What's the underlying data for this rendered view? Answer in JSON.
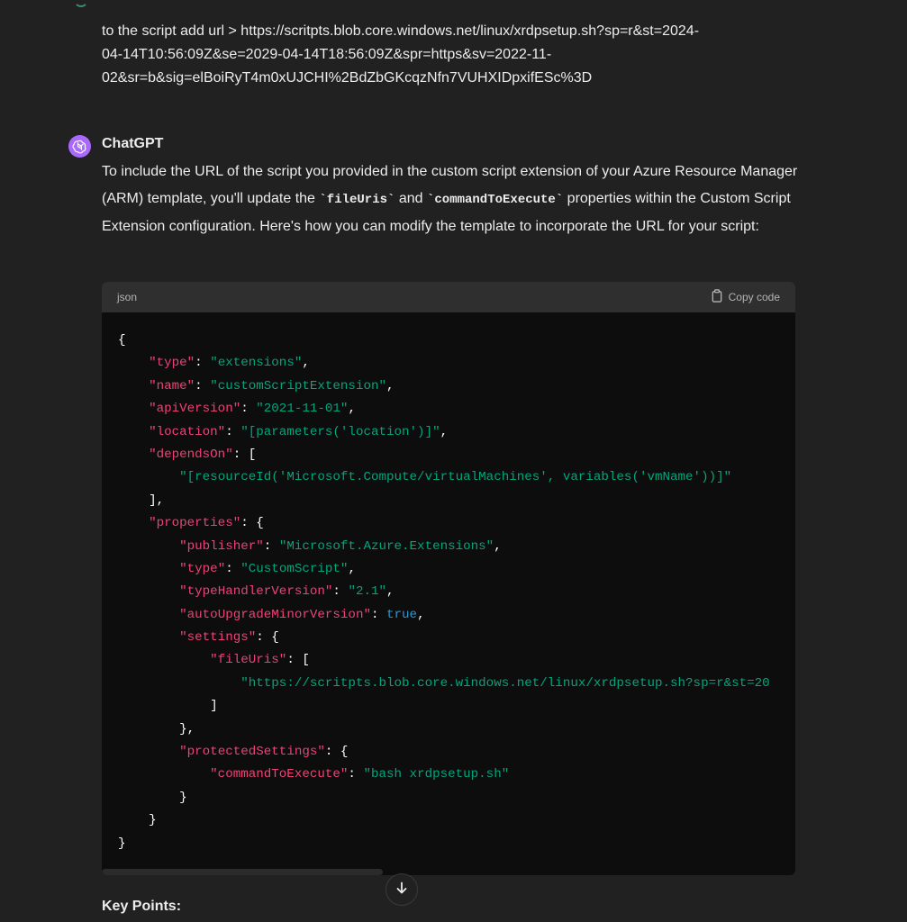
{
  "user_message": {
    "lines": [
      "to the script add url > https://scritpts.blob.core.windows.net/linux/xrdpsetup.sh?sp=r&st=2024-",
      "04-14T10:56:09Z&se=2029-04-14T18:56:09Z&spr=https&sv=2022-11-",
      "02&sr=b&sig=elBoiRyT4m0xUJCHI%2BdZbGKcqzNfn7VUHXIDpxifESc%3D"
    ]
  },
  "assistant": {
    "name": "ChatGPT",
    "intro_part1": "To include the URL of the script you provided in the custom script extension of your Azure Resource Manager (ARM) template, you'll update the ",
    "code1": "`fileUris`",
    "intro_part2": " and ",
    "code2": "`commandToExecute`",
    "intro_part3": " properties within the Custom Script Extension configuration. Here's how you can modify the template to incorporate the URL for your script:"
  },
  "code_block": {
    "language": "json",
    "copy_label": "Copy code",
    "lines": [
      [
        {
          "t": "{",
          "c": "p"
        }
      ],
      [
        {
          "t": "    "
        },
        {
          "t": "\"type\"",
          "c": "k"
        },
        {
          "t": ": ",
          "c": "p"
        },
        {
          "t": "\"extensions\"",
          "c": "s"
        },
        {
          "t": ",",
          "c": "p"
        }
      ],
      [
        {
          "t": "    "
        },
        {
          "t": "\"name\"",
          "c": "k"
        },
        {
          "t": ": ",
          "c": "p"
        },
        {
          "t": "\"customScriptExtension\"",
          "c": "s"
        },
        {
          "t": ",",
          "c": "p"
        }
      ],
      [
        {
          "t": "    "
        },
        {
          "t": "\"apiVersion\"",
          "c": "k"
        },
        {
          "t": ": ",
          "c": "p"
        },
        {
          "t": "\"2021-11-01\"",
          "c": "s"
        },
        {
          "t": ",",
          "c": "p"
        }
      ],
      [
        {
          "t": "    "
        },
        {
          "t": "\"location\"",
          "c": "k"
        },
        {
          "t": ": ",
          "c": "p"
        },
        {
          "t": "\"[parameters('location')]\"",
          "c": "s"
        },
        {
          "t": ",",
          "c": "p"
        }
      ],
      [
        {
          "t": "    "
        },
        {
          "t": "\"dependsOn\"",
          "c": "k"
        },
        {
          "t": ": [",
          "c": "p"
        }
      ],
      [
        {
          "t": "        "
        },
        {
          "t": "\"[resourceId('Microsoft.Compute/virtualMachines', variables('vmName'))]\"",
          "c": "s"
        }
      ],
      [
        {
          "t": "    "
        },
        {
          "t": "],",
          "c": "p"
        }
      ],
      [
        {
          "t": "    "
        },
        {
          "t": "\"properties\"",
          "c": "k"
        },
        {
          "t": ": {",
          "c": "p"
        }
      ],
      [
        {
          "t": "        "
        },
        {
          "t": "\"publisher\"",
          "c": "k"
        },
        {
          "t": ": ",
          "c": "p"
        },
        {
          "t": "\"Microsoft.Azure.Extensions\"",
          "c": "s"
        },
        {
          "t": ",",
          "c": "p"
        }
      ],
      [
        {
          "t": "        "
        },
        {
          "t": "\"type\"",
          "c": "k"
        },
        {
          "t": ": ",
          "c": "p"
        },
        {
          "t": "\"CustomScript\"",
          "c": "s"
        },
        {
          "t": ",",
          "c": "p"
        }
      ],
      [
        {
          "t": "        "
        },
        {
          "t": "\"typeHandlerVersion\"",
          "c": "k"
        },
        {
          "t": ": ",
          "c": "p"
        },
        {
          "t": "\"2.1\"",
          "c": "s"
        },
        {
          "t": ",",
          "c": "p"
        }
      ],
      [
        {
          "t": "        "
        },
        {
          "t": "\"autoUpgradeMinorVersion\"",
          "c": "k"
        },
        {
          "t": ": ",
          "c": "p"
        },
        {
          "t": "true",
          "c": "b"
        },
        {
          "t": ",",
          "c": "p"
        }
      ],
      [
        {
          "t": "        "
        },
        {
          "t": "\"settings\"",
          "c": "k"
        },
        {
          "t": ": {",
          "c": "p"
        }
      ],
      [
        {
          "t": "            "
        },
        {
          "t": "\"fileUris\"",
          "c": "k"
        },
        {
          "t": ": [",
          "c": "p"
        }
      ],
      [
        {
          "t": "                "
        },
        {
          "t": "\"https://scritpts.blob.core.windows.net/linux/xrdpsetup.sh?sp=r&st=20",
          "c": "s"
        }
      ],
      [
        {
          "t": "            "
        },
        {
          "t": "]",
          "c": "p"
        }
      ],
      [
        {
          "t": "        "
        },
        {
          "t": "},",
          "c": "p"
        }
      ],
      [
        {
          "t": "        "
        },
        {
          "t": "\"protectedSettings\"",
          "c": "k"
        },
        {
          "t": ": {",
          "c": "p"
        }
      ],
      [
        {
          "t": "            "
        },
        {
          "t": "\"commandToExecute\"",
          "c": "k"
        },
        {
          "t": ": ",
          "c": "p"
        },
        {
          "t": "\"bash xrdpsetup.sh\"",
          "c": "s"
        }
      ],
      [
        {
          "t": "        "
        },
        {
          "t": "}",
          "c": "p"
        }
      ],
      [
        {
          "t": "    "
        },
        {
          "t": "}",
          "c": "p"
        }
      ],
      [
        {
          "t": "}",
          "c": "p"
        }
      ]
    ]
  },
  "key_points_label": "Key Points:",
  "icons": {
    "assistant_avatar": "openai-logo-icon",
    "copy": "clipboard-icon",
    "scroll_down": "arrow-down-icon"
  },
  "colors": {
    "background": "#212121",
    "avatar": "#ab68ff",
    "code_key": "#ef4177",
    "code_string": "#00a67d",
    "code_boolean": "#2e95d3"
  }
}
